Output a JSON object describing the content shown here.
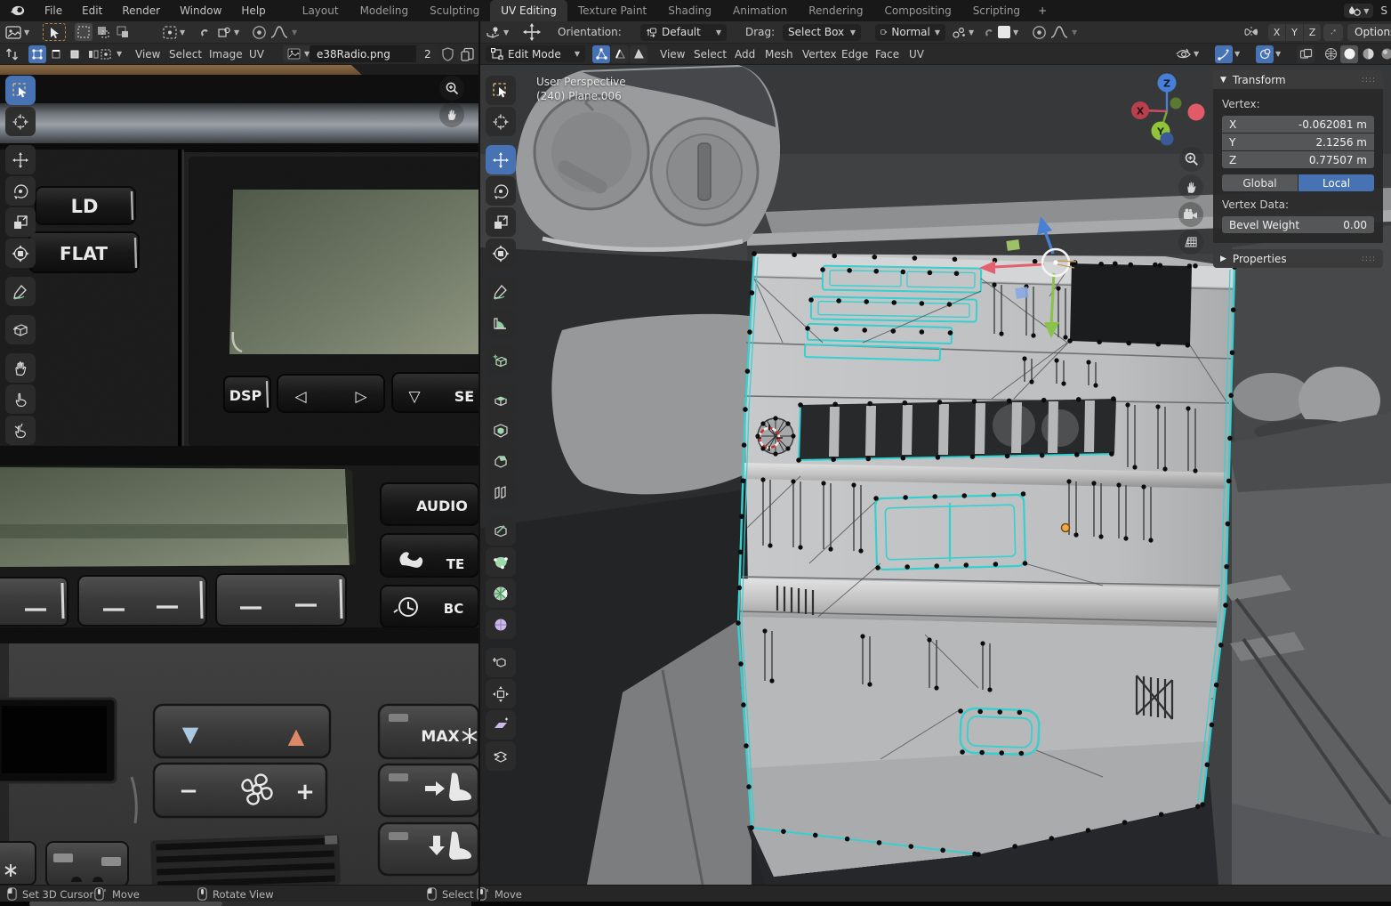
{
  "topbar": {
    "menus": [
      "File",
      "Edit",
      "Render",
      "Window",
      "Help"
    ],
    "tabs": [
      "Layout",
      "Modeling",
      "Sculpting",
      "UV Editing",
      "Texture Paint",
      "Shading",
      "Animation",
      "Rendering",
      "Compositing",
      "Scripting"
    ],
    "active_tab": "UV Editing",
    "new_tab": "+",
    "scene_partial": "S"
  },
  "uv": {
    "menus": [
      "View",
      "Select",
      "Image",
      "UV"
    ],
    "image_name": "e38Radio.png",
    "users_count": "2"
  },
  "radio": {
    "ld": "LD",
    "flat": "FLAT",
    "dsp": "DSP",
    "prev": "◁",
    "next": "▷",
    "down": "▽",
    "se": "SE",
    "audio": "AUDIO",
    "tel": "TE",
    "bc": "BC",
    "minus": "−",
    "plus": "+",
    "max": "MAX",
    "temp_down": "▼",
    "temp_up": "▲"
  },
  "vp": {
    "orientation_label": "Orientation:",
    "orientation": "Default",
    "drag_label": "Drag:",
    "drag": "Select Box",
    "pivot": "Normal",
    "mode": "Edit Mode",
    "menus": [
      "View",
      "Select",
      "Add",
      "Mesh",
      "Vertex",
      "Edge",
      "Face",
      "UV"
    ],
    "axis": [
      "X",
      "Y",
      "Z"
    ],
    "options": "Options",
    "overlay_line1": "User Perspective",
    "overlay_line2": "(240) Plane.006",
    "gizmo": {
      "x": "X",
      "y": "Y",
      "z": "Z"
    }
  },
  "sidebar": {
    "transform_title": "Transform",
    "vertex_label": "Vertex:",
    "rows": [
      {
        "axis": "X",
        "value": "-0.062081 m"
      },
      {
        "axis": "Y",
        "value": "2.1256 m"
      },
      {
        "axis": "Z",
        "value": "0.77507 m"
      }
    ],
    "global_btn": "Global",
    "local_btn": "Local",
    "vertex_data_label": "Vertex Data:",
    "bevel_label": "Bevel Weight",
    "bevel_value": "0.00",
    "properties_title": "Properties"
  },
  "statusbar": {
    "items": [
      {
        "label": "Set 3D Cursor"
      },
      {
        "label": "Move"
      },
      {
        "label": "Rotate View"
      },
      {
        "label": "Select"
      },
      {
        "label": "Move"
      }
    ]
  }
}
